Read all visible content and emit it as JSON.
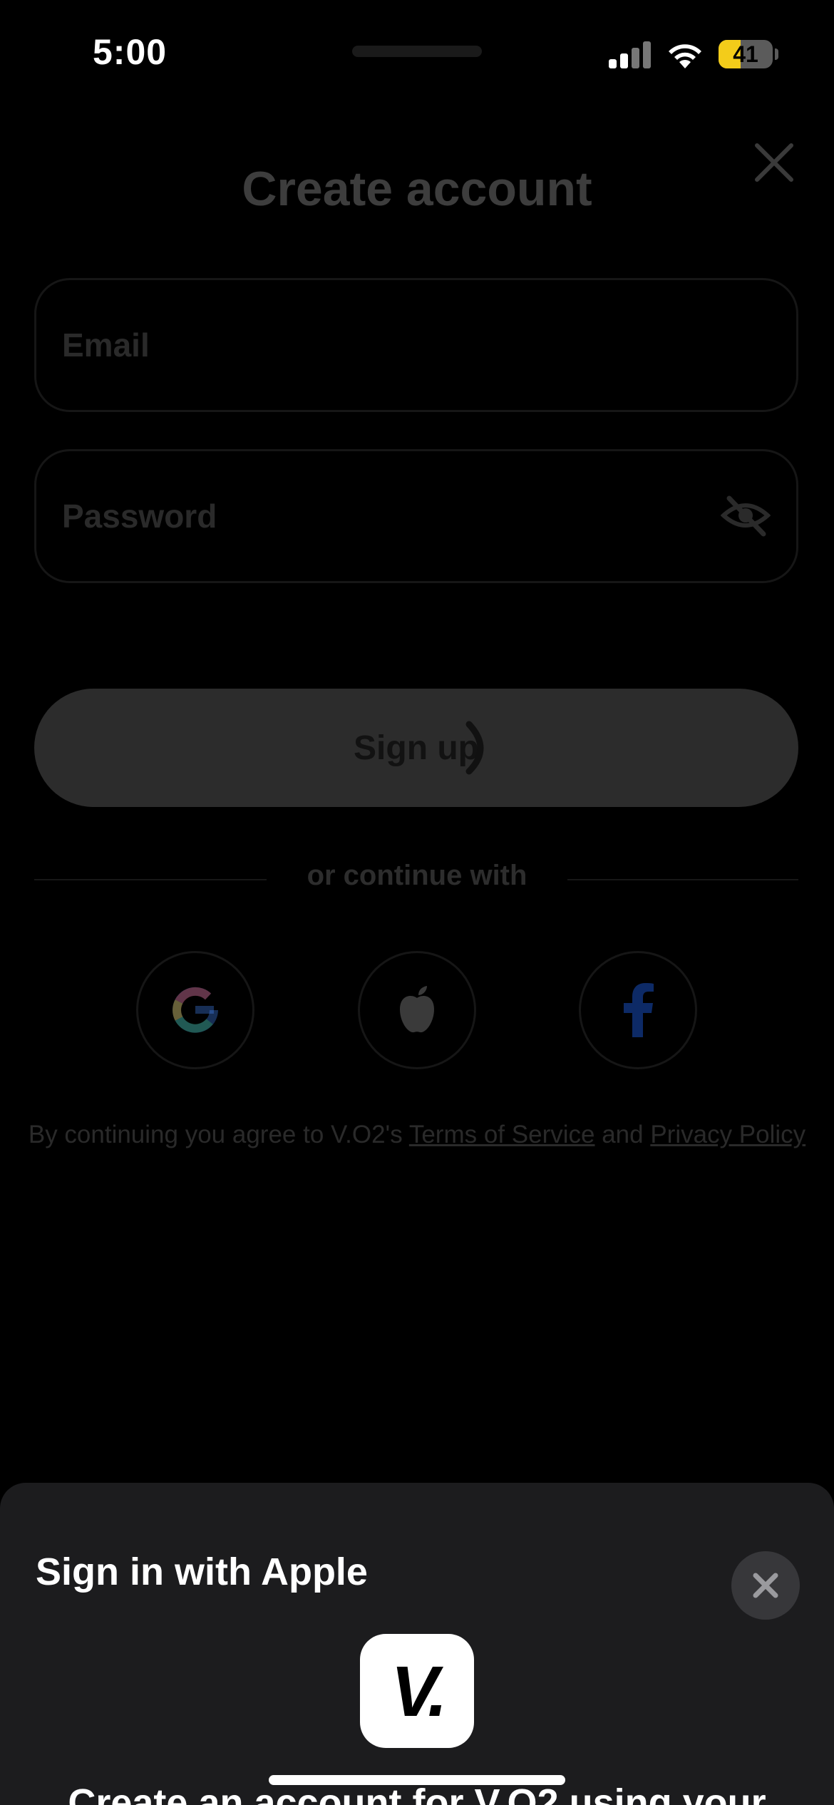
{
  "status_bar": {
    "time": "5:00",
    "battery_level": "41",
    "battery_fraction": 0.41
  },
  "form": {
    "title": "Create account",
    "email_placeholder": "Email",
    "password_placeholder": "Password",
    "signup_label": "Sign up",
    "divider_text": "or continue with",
    "social": [
      "google-icon",
      "apple-icon",
      "facebook-icon"
    ],
    "legal_prefix": "By continuing you agree to V.O2's ",
    "terms_link": "Terms of Service",
    "legal_and": " and ",
    "privacy_link": "Privacy Policy"
  },
  "sheet": {
    "title": "Sign in with Apple",
    "app_icon_text": "V.",
    "description": "Create an account for V.O2 using your"
  },
  "colors": {
    "battery": "#f3cc1a",
    "sheet_bg": "#1c1c1e",
    "google_blue": "#4285f4",
    "google_red": "#ea4335",
    "google_yellow": "#fbbc05",
    "google_green": "#34a853",
    "facebook_blue": "#0d2a66"
  }
}
